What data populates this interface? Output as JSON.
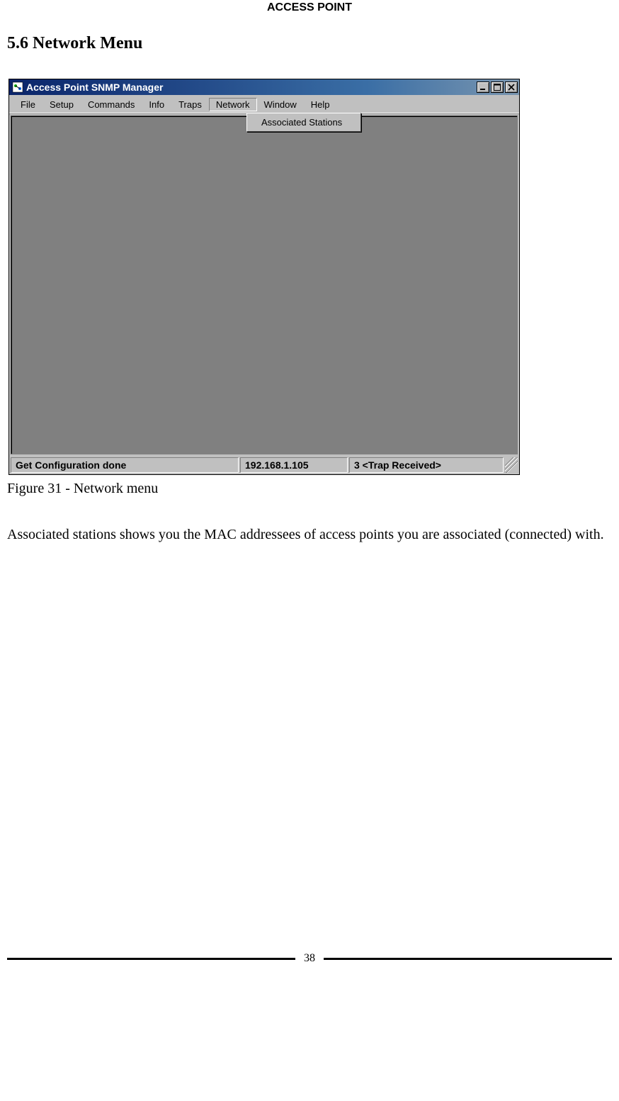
{
  "page_header": "ACCESS POINT",
  "section_title": "5.6 Network Menu",
  "app": {
    "window_title": "Access Point SNMP Manager",
    "menu": {
      "items": [
        "File",
        "Setup",
        "Commands",
        "Info",
        "Traps",
        "Network",
        "Window",
        "Help"
      ],
      "selected_index": 5
    },
    "dropdown": {
      "items": [
        "Associated Stations"
      ]
    },
    "status": {
      "message": "Get Configuration done",
      "ip": "192.168.1.105",
      "trap": "3 <Trap Received>"
    }
  },
  "figure_caption": "Figure 31 - Network menu",
  "body_text": "Associated stations shows you the MAC addressees of access points you are associated (connected) with.",
  "page_number": "38"
}
